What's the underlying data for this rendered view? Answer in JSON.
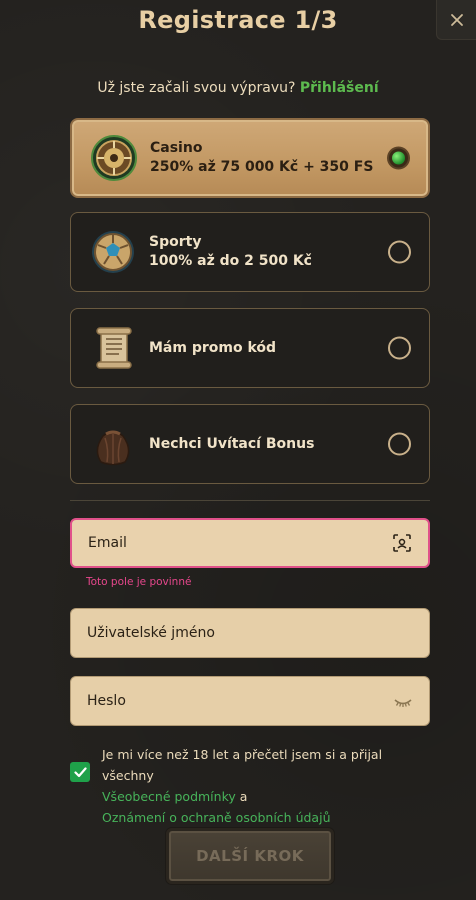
{
  "header": {
    "title": "Registrace 1/3"
  },
  "login_prompt": {
    "text": "Už jste začali svou výpravu?",
    "link": "Přihlášení"
  },
  "bonuses": [
    {
      "line1": "Casino",
      "line2": "250% až 75 000 Kč + 350 FS",
      "icon": "roulette-icon",
      "selected": true
    },
    {
      "line1": "Sporty",
      "line2": "100% až do 2 500 Kč",
      "icon": "football-icon",
      "selected": false
    },
    {
      "line1": "Mám promo kód",
      "line2": "",
      "icon": "scroll-icon",
      "selected": false
    },
    {
      "line1": "Nechci Uvítací Bonus",
      "line2": "",
      "icon": "pouch-icon",
      "selected": false
    }
  ],
  "form": {
    "email": {
      "placeholder": "Email",
      "error": "Toto pole je povinné",
      "icon": "scan-face-icon"
    },
    "username": {
      "placeholder": "Uživatelské jméno"
    },
    "password": {
      "placeholder": "Heslo",
      "icon": "eye-closed-icon"
    }
  },
  "consent": {
    "text": "Je mi více než 18 let a přečetl jsem si a přijal všechny",
    "terms_link": "Všeobecné podmínky",
    "and": "a",
    "privacy_link": "Oznámení o ochraně osobních údajů",
    "checked": true
  },
  "next_button": {
    "label": "DALŠÍ KROK"
  },
  "colors": {
    "accent_green": "#47b35a",
    "error_pink": "#e0518a",
    "field_bg": "#e6cfa8",
    "selected_bg": "#c29863"
  }
}
